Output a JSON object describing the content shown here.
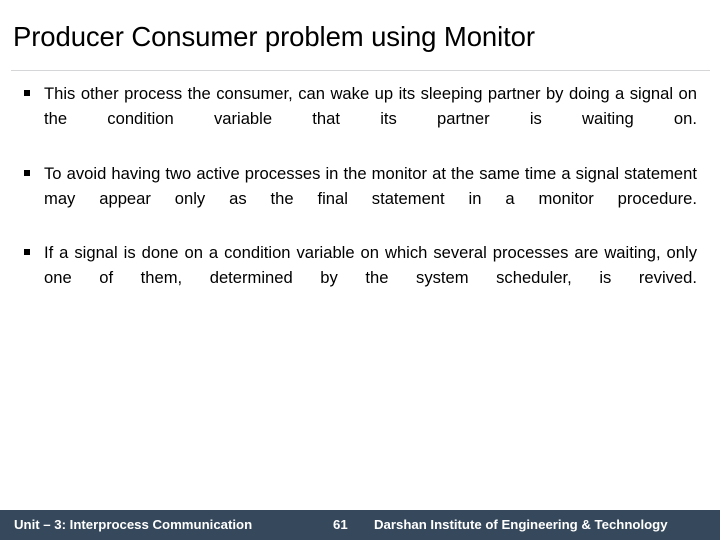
{
  "slide": {
    "title": "Producer Consumer problem using Monitor",
    "bullet_marker_glyph": "§",
    "bullets": [
      {
        "text": "This other process the consumer, can wake up its sleeping partner by doing a signal on the condition variable that its partner is waiting on."
      },
      {
        "text": "To avoid having two active processes in the monitor at the same time a signal statement may appear only as the final statement in a monitor procedure."
      },
      {
        "text": "If a signal is done on a condition variable on which several processes are waiting, only one of them, determined by the system scheduler, is revived."
      }
    ],
    "footer": {
      "unit": "Unit – 3: Interprocess Communication",
      "page_number": "61",
      "institute": "Darshan Institute of Engineering & Technology"
    },
    "colors": {
      "footer_background": "#36495c",
      "footer_text": "#ffffff",
      "title_text": "#000000",
      "body_text": "#000000",
      "rule": "#d5d6d8",
      "slide_background": "#ffffff"
    }
  }
}
